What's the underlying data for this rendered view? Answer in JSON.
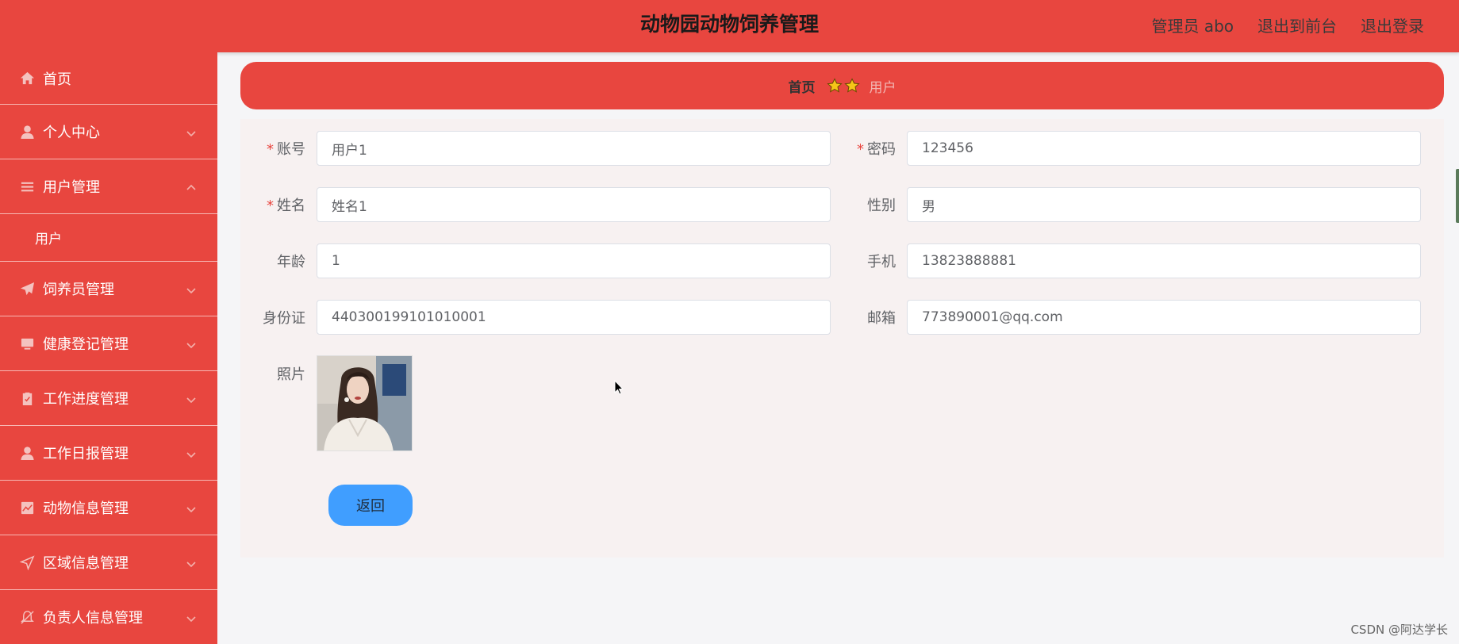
{
  "app": {
    "title": "动物园动物饲养管理",
    "user_label": "管理员 abo",
    "front_link": "退出到前台",
    "logout_link": "退出登录"
  },
  "sidebar": {
    "items": [
      {
        "label": "首页",
        "icon": "home-icon"
      },
      {
        "label": "个人中心",
        "icon": "user-icon"
      },
      {
        "label": "用户管理",
        "icon": "list-icon",
        "expanded": true,
        "children": [
          {
            "label": "用户"
          }
        ]
      },
      {
        "label": "饲养员管理",
        "icon": "send-icon"
      },
      {
        "label": "健康登记管理",
        "icon": "monitor-icon"
      },
      {
        "label": "工作进度管理",
        "icon": "clipboard-icon"
      },
      {
        "label": "工作日报管理",
        "icon": "user-icon"
      },
      {
        "label": "动物信息管理",
        "icon": "chart-icon"
      },
      {
        "label": "区域信息管理",
        "icon": "location-icon"
      },
      {
        "label": "负责人信息管理",
        "icon": "bell-off-icon"
      }
    ]
  },
  "breadcrumb": {
    "home": "首页",
    "current": "用户"
  },
  "form": {
    "account_label": "账号",
    "account_value": "用户1",
    "password_label": "密码",
    "password_value": "123456",
    "name_label": "姓名",
    "name_value": "姓名1",
    "gender_label": "性别",
    "gender_value": "男",
    "age_label": "年龄",
    "age_value": "1",
    "phone_label": "手机",
    "phone_value": "13823888881",
    "idcard_label": "身份证",
    "idcard_value": "440300199101010001",
    "email_label": "邮箱",
    "email_value": "773890001@qq.com",
    "photo_label": "照片",
    "required_mark": "*",
    "back_button": "返回"
  },
  "watermark": "CSDN @阿达学长",
  "colors": {
    "primary": "#e8463f",
    "button": "#409eff",
    "star": "#f5c518"
  }
}
